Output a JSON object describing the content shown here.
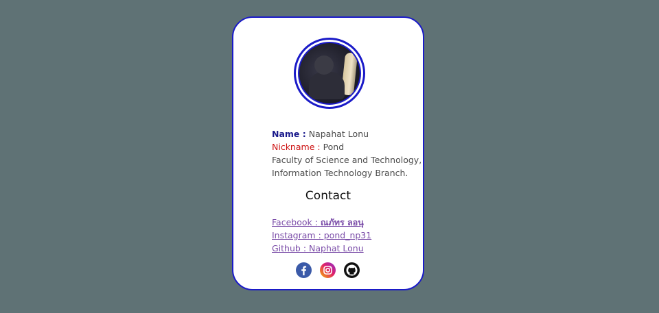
{
  "profile": {
    "name_label": "Name :",
    "name_value": "Napahat Lonu",
    "nickname_label": "Nickname :",
    "nickname_value": "Pond",
    "faculty_line1": "Faculty of Science and Technology,",
    "faculty_line2": "Information Technology Branch."
  },
  "contact": {
    "title": "Contact",
    "facebook_prefix": "Facebook :",
    "facebook_name": "ณภัทร ลอนุ",
    "instagram": "Instagram : pond_np31",
    "github": "Github : Naphat Lonu"
  },
  "social_icons": [
    "facebook-icon",
    "instagram-icon",
    "github-icon"
  ],
  "colors": {
    "background": "#5f7275",
    "card_border": "#1a1ac8",
    "name_label": "#1a1a8c",
    "nickname_label": "#cc1010",
    "link": "#7a4ca8"
  }
}
